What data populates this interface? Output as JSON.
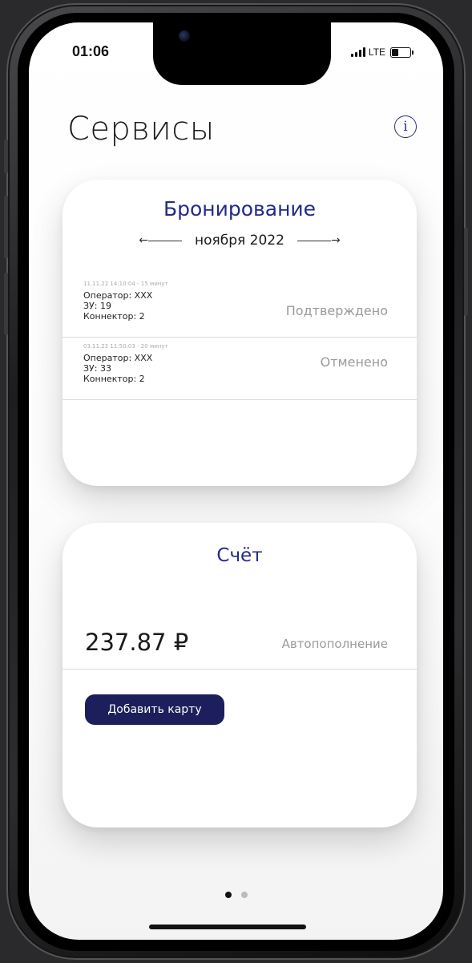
{
  "status_bar": {
    "time": "01:06",
    "network": "LTE",
    "battery_level": 0.4
  },
  "page": {
    "title": "Сервисы",
    "info_icon": "info-circle-icon"
  },
  "booking_card": {
    "title": "Бронирование",
    "month": "ноября 2022",
    "prev_arrow": "arrow-left-icon",
    "next_arrow": "arrow-right-icon",
    "items": [
      {
        "meta": "11.11.22 14:10:04 - 15 минут",
        "operator": "Оператор: XXX",
        "station": "ЗУ: 19",
        "connector": "Коннектор: 2",
        "status": "Подтверждено"
      },
      {
        "meta": "03.11.22 11:50:03 - 20 минут",
        "operator": "Оператор: XXX",
        "station": "ЗУ: 33",
        "connector": "Коннектор: 2",
        "status": "Отменено"
      }
    ]
  },
  "account_card": {
    "title": "Счёт",
    "balance": "237.87 ₽",
    "autorefill_label": "Автопополнение",
    "add_card_label": "Добавить карту"
  },
  "pager": {
    "pages": 2,
    "active": 1
  },
  "colors": {
    "accent": "#23298a",
    "button": "#1c1f5c",
    "muted": "#9a9a9a",
    "active_dot": "#111111",
    "inactive_dot": "#bbbbbb"
  }
}
